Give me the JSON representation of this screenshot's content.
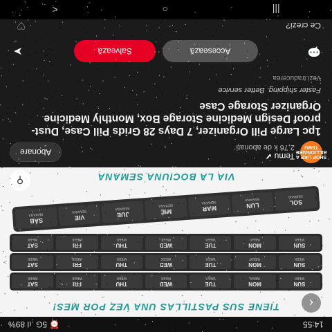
{
  "status_bar": {
    "time": "14:55",
    "indicators": "⏰ 5G .ıl 89%"
  },
  "hero": {
    "top_text": "TIENE SUS PASTILLAS UNA VEZ POR MES!",
    "bottom_text": "VIA LA BOCIUNA SEMANA",
    "week_rows": [
      [
        "SUN",
        "MON",
        "TUE",
        "WED",
        "THU",
        "FRI",
        "SAT"
      ],
      [
        "SUN",
        "MON",
        "TUE",
        "WED",
        "THU",
        "FRI",
        "SAT"
      ],
      [
        "SUN",
        "MON",
        "TUE",
        "WED",
        "THU",
        "FRI",
        "SAT"
      ]
    ],
    "week_sublabel": "WEEK",
    "monthly_row": [
      "SOL",
      "LUN",
      "MAR",
      "MIÉ",
      "JUE",
      "VIE",
      "SÁB"
    ],
    "monthly_sublabel": "SEMANA",
    "back_icon": "back-arrow-icon",
    "lens_icon": "visual-search-icon"
  },
  "store": {
    "logo_text": "SHOP LIKE A BILLIONAIRE TEMU",
    "name": "Temu",
    "verified_icon": "verified-icon",
    "subscribers": "2,76 k de abonați",
    "subscribe_label": "Abonare"
  },
  "product": {
    "title": "1pc Large Pill Organizer, 7 Days 28 Grids Pill Case, Dust-proof Design Medicine Storage Box, Monthly Medicine Organizer Storage Case",
    "tagline": "Faster shipping. Better service",
    "domain": "Vezi.traducerea"
  },
  "actions": {
    "visit_label": "Accesează",
    "save_label": "Salvează",
    "comment_icon": "comment-icon",
    "share_icon": "share-icon"
  },
  "footer": {
    "question": "Ce crezi?",
    "heart_icon": "heart-icon"
  },
  "nav": {
    "recents": "|||",
    "home": "○",
    "back": "<"
  },
  "colors": {
    "save": "#e60023",
    "brand_accent": "#1e9b93",
    "temu": "#f47a20"
  }
}
